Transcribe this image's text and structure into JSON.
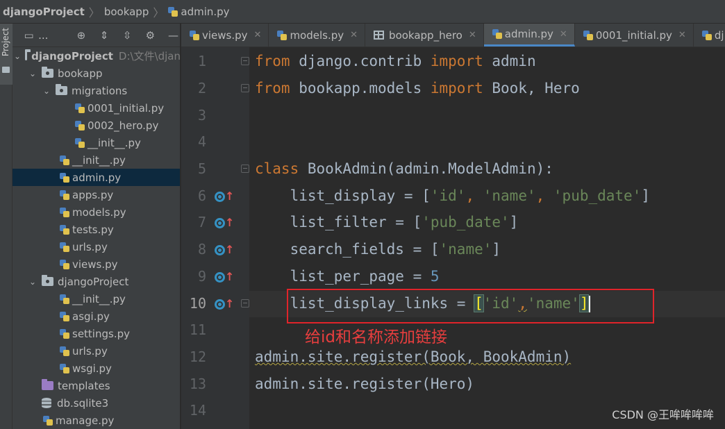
{
  "breadcrumb": {
    "project": "djangoProject",
    "folder": "bookapp",
    "file": "admin.py"
  },
  "toolstrip": {
    "project_label": "Project"
  },
  "panel": {
    "title": "..."
  },
  "tree": [
    {
      "label": "djangoProject",
      "extra": "D:\\文件\\djan",
      "type": "folder"
    },
    {
      "label": "bookapp",
      "type": "folder"
    },
    {
      "label": "migrations",
      "type": "folder"
    },
    {
      "label": "0001_initial.py",
      "type": "py"
    },
    {
      "label": "0002_hero.py",
      "type": "py"
    },
    {
      "label": "__init__.py",
      "type": "py"
    },
    {
      "label": "__init__.py",
      "type": "py"
    },
    {
      "label": "admin.py",
      "type": "py",
      "selected": true
    },
    {
      "label": "apps.py",
      "type": "py"
    },
    {
      "label": "models.py",
      "type": "py"
    },
    {
      "label": "tests.py",
      "type": "py"
    },
    {
      "label": "urls.py",
      "type": "py"
    },
    {
      "label": "views.py",
      "type": "py"
    },
    {
      "label": "djangoProject",
      "type": "folder"
    },
    {
      "label": "__init__.py",
      "type": "py"
    },
    {
      "label": "asgi.py",
      "type": "py"
    },
    {
      "label": "settings.py",
      "type": "py"
    },
    {
      "label": "urls.py",
      "type": "py"
    },
    {
      "label": "wsgi.py",
      "type": "py"
    },
    {
      "label": "templates",
      "type": "folder-purple"
    },
    {
      "label": "db.sqlite3",
      "type": "db"
    },
    {
      "label": "manage.py",
      "type": "py"
    }
  ],
  "tabs": [
    {
      "label": "views.py",
      "close": "✕"
    },
    {
      "label": "models.py",
      "close": "✕"
    },
    {
      "label": "bookapp_hero",
      "close": "✕"
    },
    {
      "label": "admin.py",
      "close": "✕",
      "active": true
    },
    {
      "label": "0001_initial.py",
      "close": "✕"
    },
    {
      "label": "dj",
      "close": ""
    }
  ],
  "line_numbers": [
    "1",
    "2",
    "3",
    "4",
    "5",
    "6",
    "7",
    "8",
    "9",
    "10",
    "11",
    "12",
    "13",
    "14"
  ],
  "code": {
    "l1": {
      "kw1": "from",
      "mod": " django.contrib ",
      "kw2": "import",
      "name": " admin"
    },
    "l2": {
      "kw1": "from",
      "mod": " bookapp.models ",
      "kw2": "import",
      "name": " Book, Hero"
    },
    "l5": {
      "kw": "class",
      "rest": " BookAdmin(admin.ModelAdmin):"
    },
    "l6": {
      "pre": "    list_display = [",
      "s1": "'id'",
      "c1": ", ",
      "s2": "'name'",
      "c2": ", ",
      "s3": "'pub_date'",
      "post": "]"
    },
    "l7": {
      "pre": "    list_filter = [",
      "s1": "'pub_date'",
      "post": "]"
    },
    "l8": {
      "pre": "    search_fields = [",
      "s1": "'name'",
      "post": "]"
    },
    "l9": {
      "pre": "    list_per_page = ",
      "num": "5"
    },
    "l10": {
      "pre": "    list_display_links = ",
      "open": "[",
      "s1": "'id'",
      "c1": ",",
      "s2": "'name'",
      "close": "]"
    },
    "l12": {
      "text": "admin.site.register(Book, BookAdmin)"
    },
    "l13": {
      "text": "admin.site.register(Hero)"
    }
  },
  "annotation": "给id和名称添加链接",
  "watermark": "CSDN @王哞哞哞哞"
}
